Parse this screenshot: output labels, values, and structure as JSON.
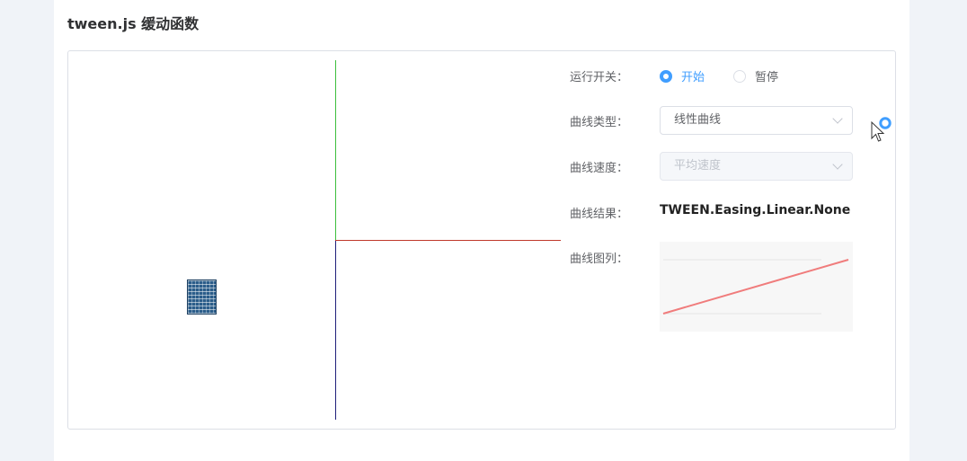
{
  "page": {
    "title": "tween.js 缓动函数"
  },
  "controls": {
    "run_switch": {
      "label": "运行开关：",
      "options": [
        {
          "label": "开始",
          "checked": true
        },
        {
          "label": "暂停",
          "checked": false
        }
      ]
    },
    "curve_type": {
      "label": "曲线类型：",
      "value": "线性曲线"
    },
    "curve_speed": {
      "label": "曲线速度：",
      "value": "平均速度",
      "disabled": true
    },
    "curve_result": {
      "label": "曲线结果：",
      "value": "TWEEN.Easing.Linear.None"
    },
    "curve_preview": {
      "label": "曲线图列："
    }
  },
  "colors": {
    "accent": "#409eff",
    "axis_up": "#3cbf3c",
    "axis_down": "#1f1f7a",
    "axis_x": "#c0392b",
    "curve": "#f07c7c"
  },
  "icons": {
    "cursor": "mouse-pointer-icon",
    "chevron": "chevron-down-icon"
  }
}
